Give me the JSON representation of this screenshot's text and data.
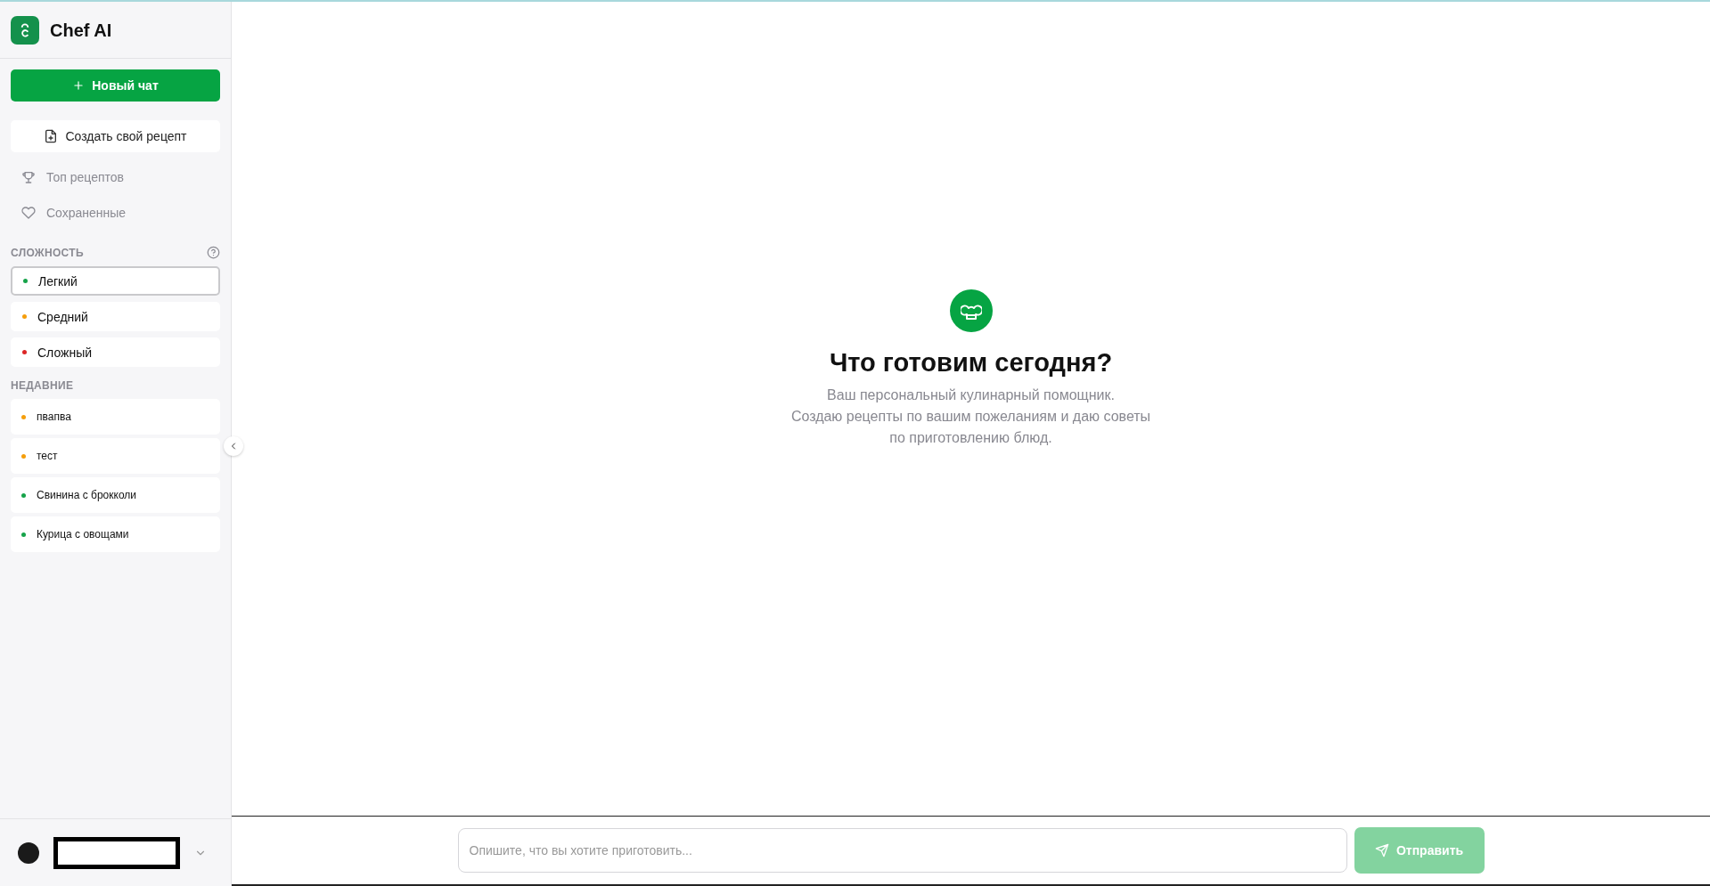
{
  "app": {
    "title": "Chef AI"
  },
  "actions": [
    {
      "kind": "primary",
      "label": "Новый чат"
    },
    {
      "kind": "secondary",
      "label": "Создать свой рецепт"
    }
  ],
  "nav": [
    {
      "kind": "trophy",
      "label": "Топ рецептов"
    },
    {
      "kind": "heart",
      "label": "Сохраненные"
    }
  ],
  "difficulty": {
    "heading": "СЛОЖНОСТЬ",
    "items": [
      {
        "label": "Легкий",
        "color": "#16a34a",
        "selected": true
      },
      {
        "label": "Средний",
        "color": "#f59e0b",
        "selected": false
      },
      {
        "label": "Сложный",
        "color": "#dc2626",
        "selected": false
      }
    ]
  },
  "recent": {
    "heading": "НЕДАВНИЕ",
    "items": [
      {
        "label": "пвапва",
        "color": "#f59e0b"
      },
      {
        "label": "тест",
        "color": "#f59e0b"
      },
      {
        "label": "Свинина с брокколи",
        "color": "#16a34a"
      },
      {
        "label": "Курица с овощами",
        "color": "#16a34a"
      }
    ]
  },
  "welcome": {
    "title": "Что готовим сегодня?",
    "lines": [
      "Ваш персональный кулинарный помощник.",
      "Создаю рецепты по вашим пожеланиям и даю советы",
      "по приготовлению блюд."
    ]
  },
  "composer": {
    "placeholder": "Опишите, что вы хотите приготовить...",
    "send": {
      "label": "Отправить",
      "disabled": true
    }
  }
}
